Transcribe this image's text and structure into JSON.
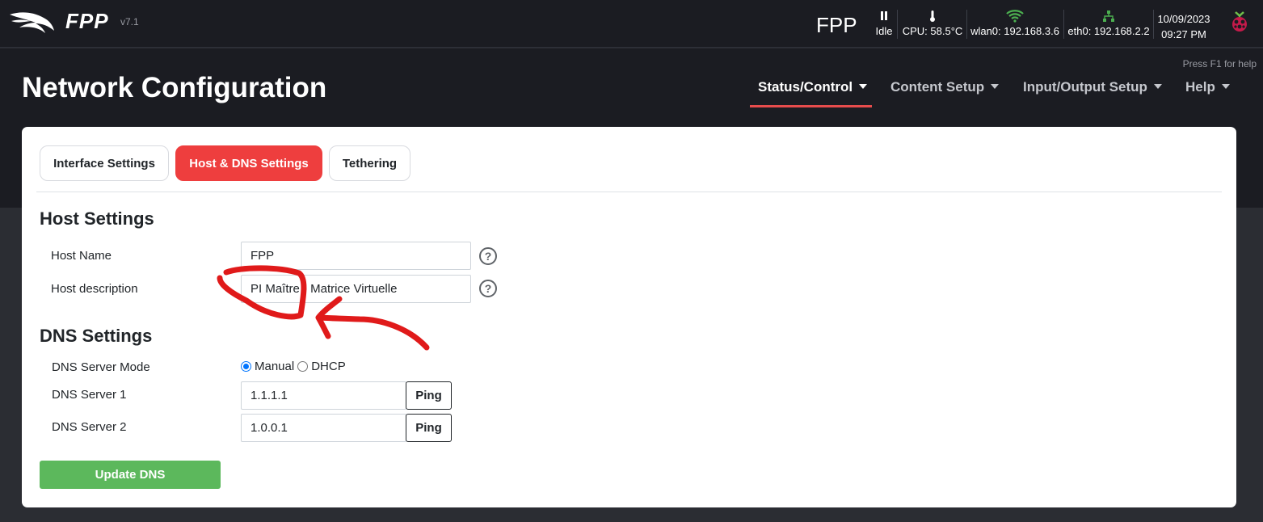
{
  "app": {
    "name": "FPP",
    "version": "v7.1"
  },
  "status_bar": {
    "hostname": "FPP",
    "player_status": "Idle",
    "cpu": "CPU: 58.5°C",
    "wlan": "wlan0: 192.168.3.6",
    "eth": "eth0: 192.168.2.2",
    "date": "10/09/2023",
    "time": "09:27 PM",
    "wifi_color": "#4caf50",
    "eth_color": "#4caf50"
  },
  "header": {
    "help_hint": "Press F1 for help",
    "page_title": "Network Configuration",
    "nav": [
      {
        "label": "Status/Control",
        "active": true
      },
      {
        "label": "Content Setup",
        "active": false
      },
      {
        "label": "Input/Output Setup",
        "active": false
      },
      {
        "label": "Help",
        "active": false
      }
    ]
  },
  "tabs": [
    {
      "label": "Interface Settings",
      "active": false
    },
    {
      "label": "Host & DNS Settings",
      "active": true
    },
    {
      "label": "Tethering",
      "active": false
    }
  ],
  "host_settings": {
    "title": "Host Settings",
    "host_name_label": "Host Name",
    "host_name_value": "FPP",
    "host_description_label": "Host description",
    "host_description_value": "PI Maître - Matrice Virtuelle"
  },
  "dns_settings": {
    "title": "DNS Settings",
    "mode_label": "DNS Server Mode",
    "mode_options": [
      "Manual",
      "DHCP"
    ],
    "mode_selected": "Manual",
    "server1_label": "DNS Server 1",
    "server1_value": "1.1.1.1",
    "server2_label": "DNS Server 2",
    "server2_value": "1.0.0.1",
    "ping_label": "Ping",
    "update_label": "Update DNS"
  },
  "colors": {
    "accent": "#ee3e3e",
    "success": "#5cb85c",
    "annotation": "#e01a1a"
  },
  "icons": [
    "fpp-logo-icon",
    "pause-icon",
    "thermometer-icon",
    "wifi-icon",
    "ethernet-icon",
    "raspberry-pi-icon",
    "help-circle-icon",
    "caret-down-icon"
  ]
}
